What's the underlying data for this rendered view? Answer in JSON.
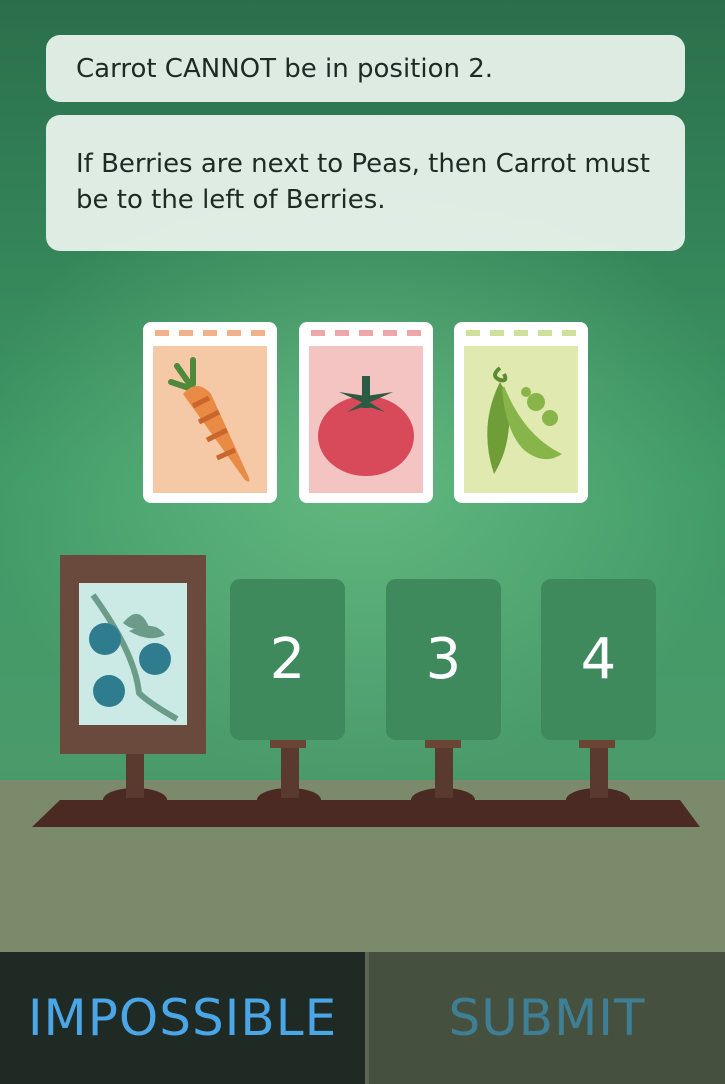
{
  "clues": [
    {
      "text": "Carrot CANNOT be in position 2."
    },
    {
      "text": "If Berries are next to Peas, then Carrot must be to the left of Berries."
    }
  ],
  "seed_packets": [
    {
      "name": "carrot",
      "icon": "carrot-icon",
      "bg": "#f5c9a6",
      "dash": "#f2b289"
    },
    {
      "name": "tomato",
      "icon": "tomato-icon",
      "bg": "#f4c4c2",
      "dash": "#eea6a8"
    },
    {
      "name": "peas",
      "icon": "pea-pod-icon",
      "bg": "#dfe9b0",
      "dash": "#cfe09a"
    }
  ],
  "positions": [
    {
      "label": "1",
      "placed": "berries",
      "icon": "blueberry-icon"
    },
    {
      "label": "2"
    },
    {
      "label": "3"
    },
    {
      "label": "4"
    }
  ],
  "buttons": {
    "impossible": "IMPOSSIBLE",
    "submit": "SUBMIT"
  },
  "colors": {
    "impossible_text": "#4aa6e6",
    "submit_text": "#3f7f96",
    "soil": "#4a2a22",
    "post": "#5a3a2e"
  }
}
